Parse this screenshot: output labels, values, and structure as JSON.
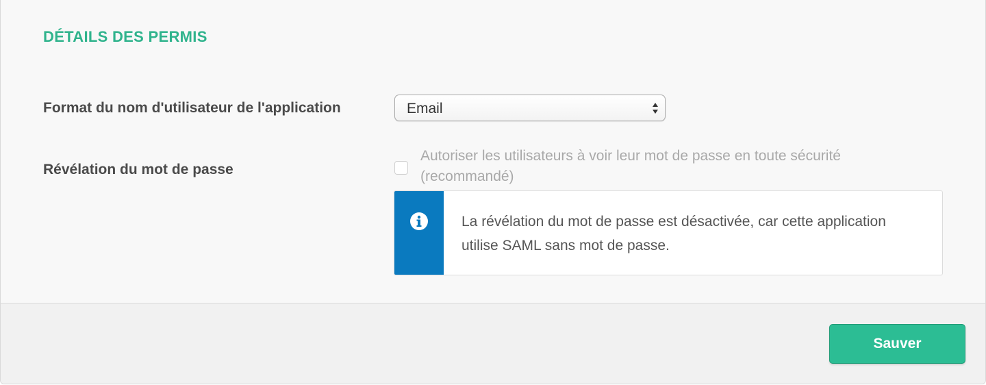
{
  "section": {
    "title": "DÉTAILS DES PERMIS"
  },
  "fields": {
    "username_format": {
      "label": "Format du nom d'utilisateur de l'application",
      "selected": "Email"
    },
    "password_reveal": {
      "label": "Révélation du mot de passe",
      "checkbox_label": "Autoriser les utilisateurs à voir leur mot de passe en toute sécurité (recommandé)",
      "checked": false,
      "disabled": true
    }
  },
  "notice": {
    "icon": "info-icon",
    "text": "La révélation du mot de passe est désactivée, car cette application utilise SAML sans mot de passe."
  },
  "footer": {
    "save_label": "Sauver"
  },
  "colors": {
    "accent": "#2fb38c",
    "button": "#2cbd94",
    "info_bar": "#0a7abf"
  }
}
